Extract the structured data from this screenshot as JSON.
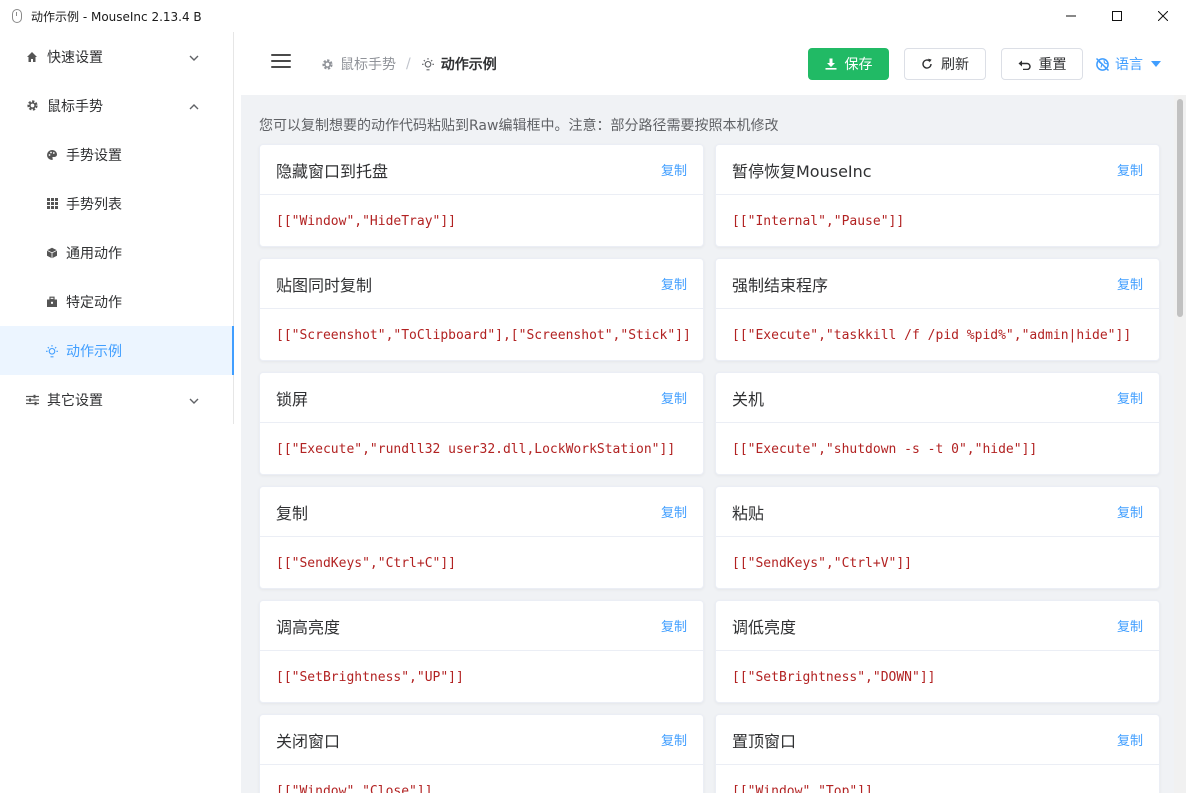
{
  "window": {
    "title": "动作示例 - MouseInc 2.13.4 B"
  },
  "sidebar": {
    "items": [
      {
        "label": "快速设置",
        "icon": "home-icon",
        "level": 1,
        "expanded": false
      },
      {
        "label": "鼠标手势",
        "icon": "gear-icon",
        "level": 1,
        "expanded": true
      },
      {
        "label": "手势设置",
        "icon": "palette-icon",
        "level": 2
      },
      {
        "label": "手势列表",
        "icon": "grid-icon",
        "level": 2
      },
      {
        "label": "通用动作",
        "icon": "cube-icon",
        "level": 2
      },
      {
        "label": "特定动作",
        "icon": "briefcase-icon",
        "level": 2
      },
      {
        "label": "动作示例",
        "icon": "bulb-icon",
        "level": 2,
        "active": true
      },
      {
        "label": "其它设置",
        "icon": "sliders-icon",
        "level": 1,
        "expanded": false
      }
    ]
  },
  "header": {
    "breadcrumb": [
      "鼠标手势",
      "动作示例"
    ],
    "breadcrumb_separator": "/",
    "save_label": "保存",
    "refresh_label": "刷新",
    "reset_label": "重置",
    "language_label": "语言"
  },
  "main": {
    "note": "您可以复制想要的动作代码粘贴到Raw编辑框中。注意：部分路径需要按照本机修改",
    "copy_label": "复制",
    "cards": [
      {
        "title": "隐藏窗口到托盘",
        "code": "[[\"Window\",\"HideTray\"]]"
      },
      {
        "title": "暂停恢复MouseInc",
        "code": "[[\"Internal\",\"Pause\"]]"
      },
      {
        "title": "贴图同时复制",
        "code": "[[\"Screenshot\",\"ToClipboard\"],[\"Screenshot\",\"Stick\"]]"
      },
      {
        "title": "强制结束程序",
        "code": "[[\"Execute\",\"taskkill /f /pid %pid%\",\"admin|hide\"]]"
      },
      {
        "title": "锁屏",
        "code": "[[\"Execute\",\"rundll32 user32.dll,LockWorkStation\"]]"
      },
      {
        "title": "关机",
        "code": "[[\"Execute\",\"shutdown -s -t 0\",\"hide\"]]"
      },
      {
        "title": "复制",
        "code": "[[\"SendKeys\",\"Ctrl+C\"]]"
      },
      {
        "title": "粘贴",
        "code": "[[\"SendKeys\",\"Ctrl+V\"]]"
      },
      {
        "title": "调高亮度",
        "code": "[[\"SetBrightness\",\"UP\"]]"
      },
      {
        "title": "调低亮度",
        "code": "[[\"SetBrightness\",\"DOWN\"]]"
      },
      {
        "title": "关闭窗口",
        "code": "[[\"Window\",\"Close\"]]"
      },
      {
        "title": "置顶窗口",
        "code": "[[\"Window\",\"Top\"]]"
      }
    ]
  },
  "colors": {
    "primary": "#409eff",
    "save": "#21ba65",
    "code": "#b22222",
    "background": "#f0f2f5"
  }
}
